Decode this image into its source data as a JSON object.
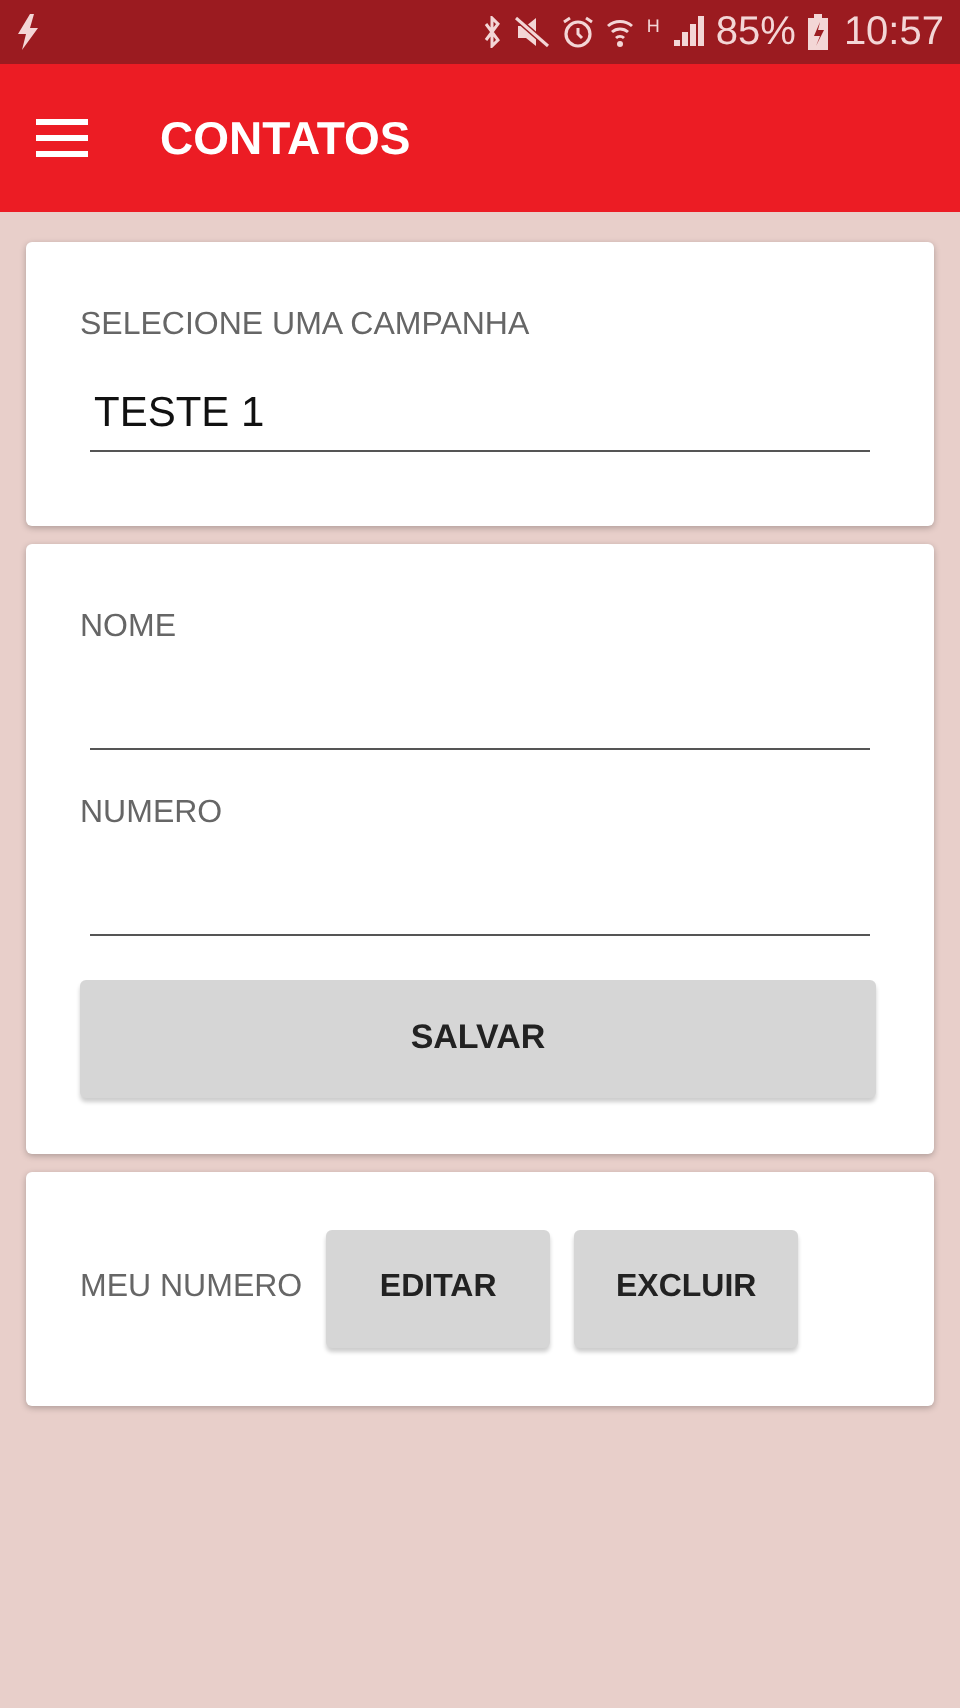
{
  "status_bar": {
    "network": "H",
    "battery": "85%",
    "time": "10:57"
  },
  "app_bar": {
    "title": "CONTATOS"
  },
  "campaign": {
    "label": "SELECIONE UMA CAMPANHA",
    "value": "TESTE 1"
  },
  "form": {
    "fields": [
      {
        "label": "NOME"
      },
      {
        "label": "NUMERO"
      }
    ],
    "button": "SALVAR"
  },
  "my_number": {
    "label": "MEU NUMERO",
    "buttons": [
      "EDITAR",
      "EXCLUIR"
    ]
  }
}
